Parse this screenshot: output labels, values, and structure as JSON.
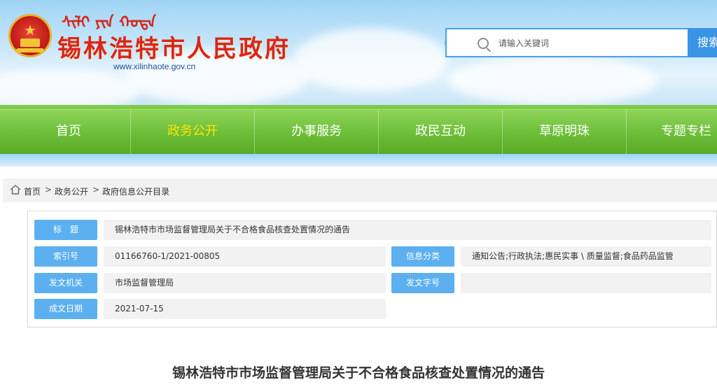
{
  "header": {
    "mongolian_script": "ᠰᠢᠯᠢ ᠶᠢᠨ ᠬᠣᠲᠠ",
    "site_name": "锡林浩特市人民政府",
    "site_url": "www.xilinhaote.gov.cn",
    "emblem_icon": "national-emblem-icon"
  },
  "search": {
    "placeholder": "请输入关键词",
    "button_label": "搜索",
    "icon": "search-icon"
  },
  "nav": {
    "items": [
      {
        "label": "首页",
        "active": false
      },
      {
        "label": "政务公开",
        "active": true
      },
      {
        "label": "办事服务",
        "active": false
      },
      {
        "label": "政民互动",
        "active": false
      },
      {
        "label": "草原明珠",
        "active": false
      },
      {
        "label": "专题专栏",
        "active": false
      }
    ],
    "active_color": "#ffe600"
  },
  "breadcrumb": {
    "home_icon": "home-icon",
    "items": [
      "首页",
      "政务公开",
      "政府信息公开目录"
    ],
    "separator": ">"
  },
  "info": {
    "title_label": "标　题",
    "title_value": "锡林浩特市市场监督管理局关于不合格食品核查处置情况的通告",
    "index_label": "索引号",
    "index_value": "01166760-1/2021-00805",
    "category_label": "信息分类",
    "category_value": "通知公告;行政执法;惠民实事 \\ 质量监督;食品药品监管",
    "issuer_label": "发文机关",
    "issuer_value": "市场监督管理局",
    "docno_label": "发文字号",
    "docno_value": "",
    "date_label": "成文日期",
    "date_value": "2021-07-15"
  },
  "document": {
    "title": "锡林浩特市市场监督管理局关于不合格食品核查处置情况的通告"
  },
  "colors": {
    "brand_red": "#d9261c",
    "nav_green": "#6cbd37",
    "label_blue": "#5cb0ef",
    "search_blue": "#3a94e6"
  }
}
